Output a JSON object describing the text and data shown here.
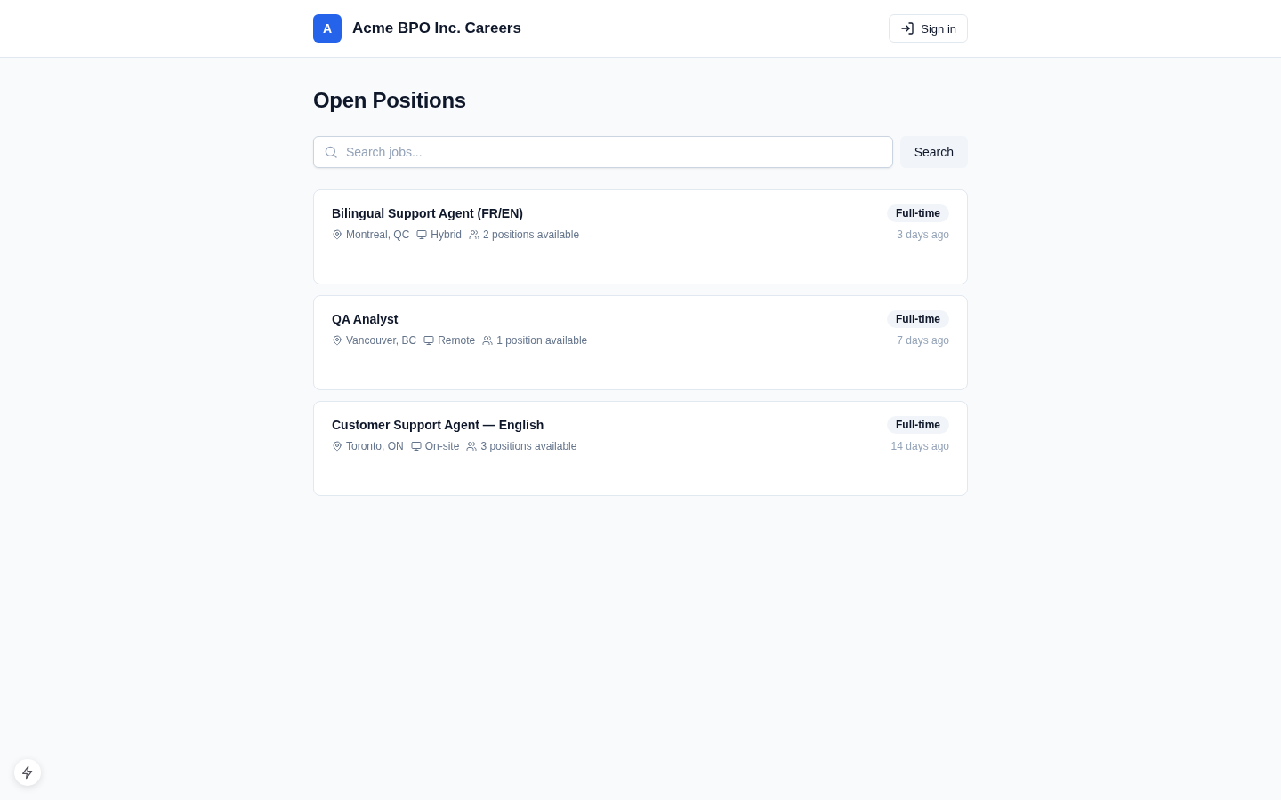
{
  "header": {
    "logo_letter": "A",
    "title": "Acme BPO Inc. Careers",
    "sign_in": "Sign in"
  },
  "page_title": "Open Positions",
  "search": {
    "placeholder": "Search jobs...",
    "button": "Search"
  },
  "jobs": [
    {
      "title": "Bilingual Support Agent (FR/EN)",
      "location": "Montreal, QC",
      "work_mode": "Hybrid",
      "openings": "2 positions available",
      "type": "Full-time",
      "posted": "3 days ago"
    },
    {
      "title": "QA Analyst",
      "location": "Vancouver, BC",
      "work_mode": "Remote",
      "openings": "1 position available",
      "type": "Full-time",
      "posted": "7 days ago"
    },
    {
      "title": "Customer Support Agent — English",
      "location": "Toronto, ON",
      "work_mode": "On-site",
      "openings": "3 positions available",
      "type": "Full-time",
      "posted": "14 days ago"
    }
  ]
}
